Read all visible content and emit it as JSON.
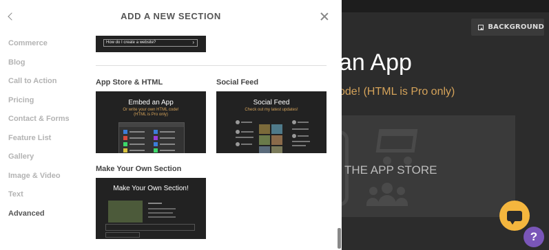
{
  "panel": {
    "title": "ADD A NEW SECTION",
    "categories": [
      {
        "label": "Commerce",
        "active": false
      },
      {
        "label": "Blog",
        "active": false
      },
      {
        "label": "Call to Action",
        "active": false
      },
      {
        "label": "Pricing",
        "active": false
      },
      {
        "label": "Contact & Forms",
        "active": false
      },
      {
        "label": "Feature List",
        "active": false
      },
      {
        "label": "Gallery",
        "active": false
      },
      {
        "label": "Image & Video",
        "active": false
      },
      {
        "label": "Text",
        "active": false
      },
      {
        "label": "Advanced",
        "active": true
      }
    ],
    "top_thumb_text": "How do I create a website?",
    "sections": [
      {
        "title": "App Store & HTML",
        "card_title": "Embed an App",
        "card_sub": "Or write your own HTML code! (HTML is Pro only)"
      },
      {
        "title": "Social Feed",
        "card_title": "Social Feed",
        "card_sub": "Check out my latest updates!"
      },
      {
        "title": "Make Your Own Section",
        "card_title": "Make Your Own Section!",
        "card_sub": ""
      }
    ]
  },
  "preview": {
    "background_button": "BACKGROUND",
    "title": "an App",
    "subtitle": "ode! (HTML is Pro only)",
    "store_text": "THE APP STORE",
    "help_label": "?"
  },
  "colors": {
    "accent": "#d5a35a",
    "chat": "#f4b63e",
    "help": "#7a56b8"
  }
}
